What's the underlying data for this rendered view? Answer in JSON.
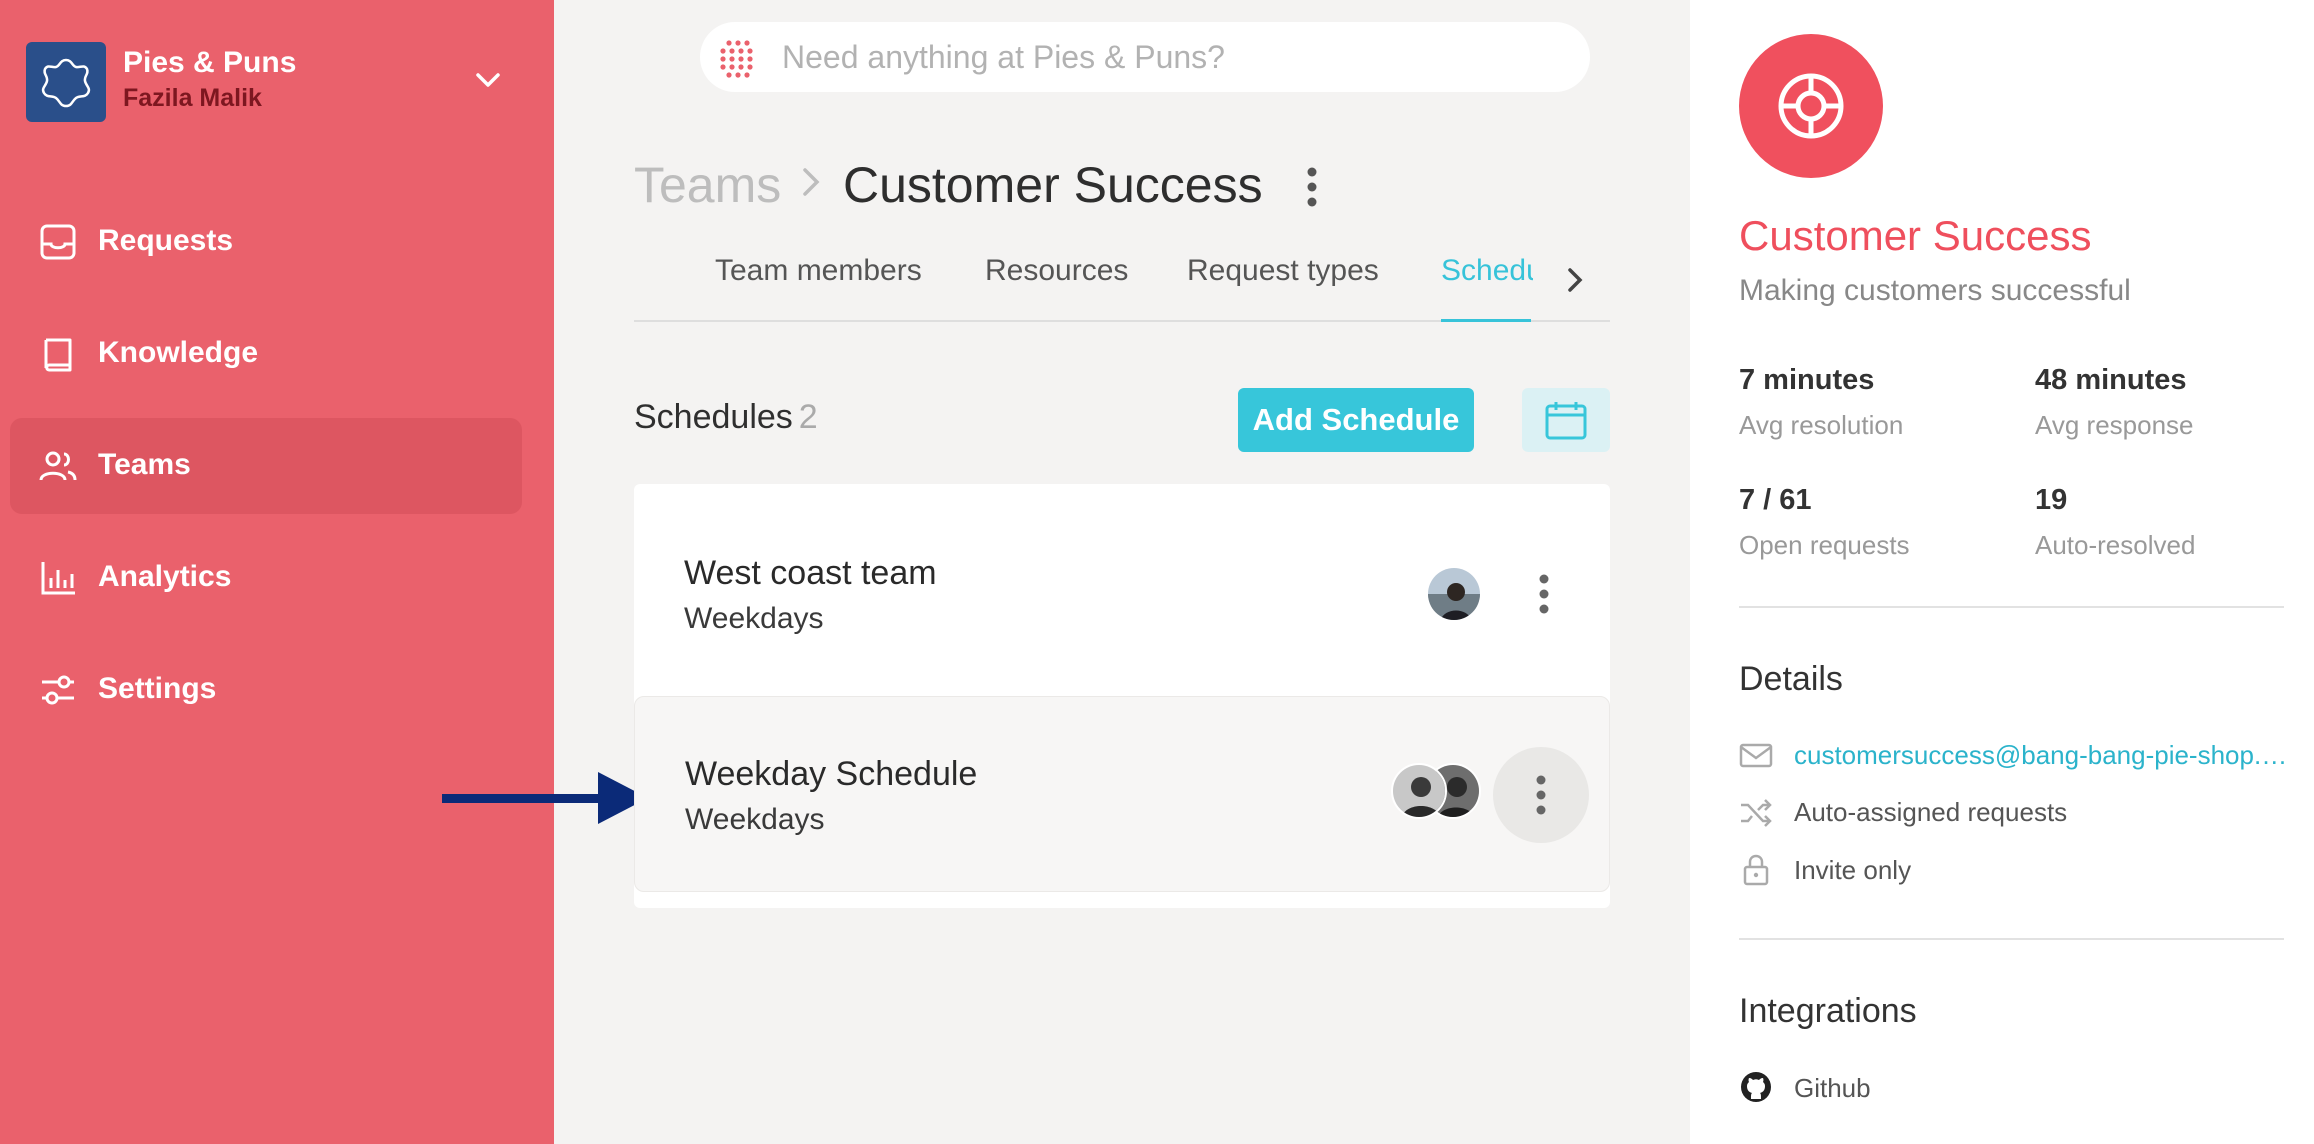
{
  "org": {
    "name": "Pies & Puns",
    "user": "Fazila Malik"
  },
  "nav": [
    {
      "label": "Requests",
      "icon": "inbox-icon"
    },
    {
      "label": "Knowledge",
      "icon": "book-icon"
    },
    {
      "label": "Teams",
      "icon": "users-icon",
      "active": true
    },
    {
      "label": "Analytics",
      "icon": "bar-chart-icon"
    },
    {
      "label": "Settings",
      "icon": "sliders-icon"
    }
  ],
  "search": {
    "placeholder": "Need anything at Pies & Puns?"
  },
  "breadcrumb": {
    "root": "Teams",
    "current": "Customer Success"
  },
  "tabs": [
    "Team members",
    "Resources",
    "Request types",
    "Schedules"
  ],
  "schedules": {
    "title": "Schedules",
    "count": "2",
    "add_label": "Add Schedule",
    "items": [
      {
        "name": "West coast team",
        "days": "Weekdays"
      },
      {
        "name": "Weekday Schedule",
        "days": "Weekdays"
      }
    ]
  },
  "panel": {
    "name": "Customer Success",
    "description": "Making customers successful",
    "stats": [
      {
        "value": "7 minutes",
        "label": "Avg resolution"
      },
      {
        "value": "48 minutes",
        "label": "Avg response"
      },
      {
        "value": "7 / 61",
        "label": "Open requests"
      },
      {
        "value": "19",
        "label": "Auto-resolved"
      }
    ],
    "details_title": "Details",
    "details": {
      "email": "customersuccess@bang-bang-pie-shop.com",
      "assignment": "Auto-assigned requests",
      "privacy": "Invite only"
    },
    "integrations_title": "Integrations",
    "integrations": [
      "Github"
    ]
  },
  "colors": {
    "sidebar": "#ea616c",
    "accent": "#37c6da",
    "brand": "#ef4f5d",
    "arrow": "#0b2a78"
  }
}
